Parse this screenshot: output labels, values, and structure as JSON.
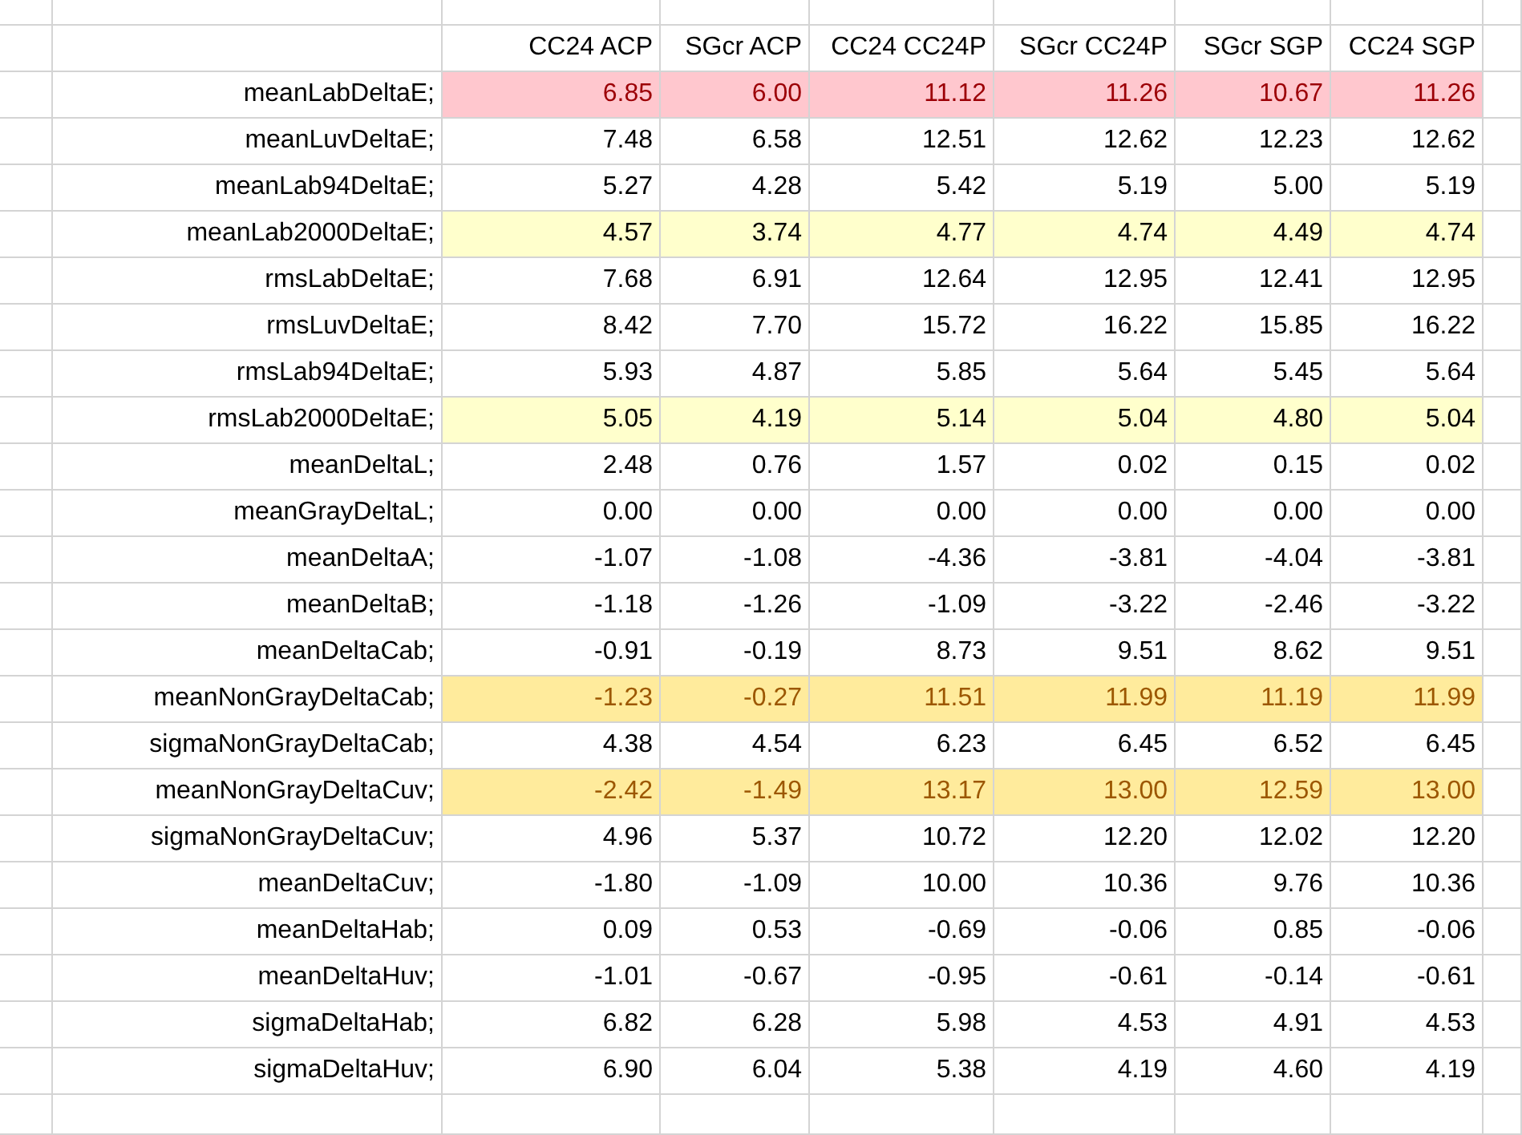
{
  "table": {
    "columns": [
      "CC24 ACP",
      "SGcr ACP",
      "CC24 CC24P",
      "SGcr CC24P",
      "SGcr SGP",
      "CC24 SGP"
    ],
    "rows": [
      {
        "label": "meanLabDeltaE;",
        "color": "#ffc7ce",
        "values": [
          "6.85",
          "6.00",
          "11.12",
          "11.26",
          "10.67",
          "11.26"
        ]
      },
      {
        "label": "meanLuvDeltaE;",
        "values": [
          "7.48",
          "6.58",
          "12.51",
          "12.62",
          "12.23",
          "12.62"
        ]
      },
      {
        "label": "meanLab94DeltaE;",
        "values": [
          "5.27",
          "4.28",
          "5.42",
          "5.19",
          "5.00",
          "5.19"
        ]
      },
      {
        "label": "meanLab2000DeltaE;",
        "color": "#ffffcc",
        "values": [
          "4.57",
          "3.74",
          "4.77",
          "4.74",
          "4.49",
          "4.74"
        ]
      },
      {
        "label": "rmsLabDeltaE;",
        "values": [
          "7.68",
          "6.91",
          "12.64",
          "12.95",
          "12.41",
          "12.95"
        ]
      },
      {
        "label": "rmsLuvDeltaE;",
        "values": [
          "8.42",
          "7.70",
          "15.72",
          "16.22",
          "15.85",
          "16.22"
        ]
      },
      {
        "label": "rmsLab94DeltaE;",
        "values": [
          "5.93",
          "4.87",
          "5.85",
          "5.64",
          "5.45",
          "5.64"
        ]
      },
      {
        "label": "rmsLab2000DeltaE;",
        "color": "#ffffcc",
        "values": [
          "5.05",
          "4.19",
          "5.14",
          "5.04",
          "4.80",
          "5.04"
        ]
      },
      {
        "label": "meanDeltaL;",
        "values": [
          "2.48",
          "0.76",
          "1.57",
          "0.02",
          "0.15",
          "0.02"
        ]
      },
      {
        "label": "meanGrayDeltaL;",
        "values": [
          "0.00",
          "0.00",
          "0.00",
          "0.00",
          "0.00",
          "0.00"
        ]
      },
      {
        "label": "meanDeltaA;",
        "values": [
          "-1.07",
          "-1.08",
          "-4.36",
          "-3.81",
          "-4.04",
          "-3.81"
        ]
      },
      {
        "label": "meanDeltaB;",
        "values": [
          "-1.18",
          "-1.26",
          "-1.09",
          "-3.22",
          "-2.46",
          "-3.22"
        ]
      },
      {
        "label": "meanDeltaCab;",
        "values": [
          "-0.91",
          "-0.19",
          "8.73",
          "9.51",
          "8.62",
          "9.51"
        ]
      },
      {
        "label": "meanNonGrayDeltaCab;",
        "color": "#ffeb9c",
        "values": [
          "-1.23",
          "-0.27",
          "11.51",
          "11.99",
          "11.19",
          "11.99"
        ]
      },
      {
        "label": "sigmaNonGrayDeltaCab;",
        "values": [
          "4.38",
          "4.54",
          "6.23",
          "6.45",
          "6.52",
          "6.45"
        ]
      },
      {
        "label": "meanNonGrayDeltaCuv;",
        "color": "#ffeb9c",
        "values": [
          "-2.42",
          "-1.49",
          "13.17",
          "13.00",
          "12.59",
          "13.00"
        ]
      },
      {
        "label": "sigmaNonGrayDeltaCuv;",
        "values": [
          "4.96",
          "5.37",
          "10.72",
          "12.20",
          "12.02",
          "12.20"
        ]
      },
      {
        "label": "meanDeltaCuv;",
        "values": [
          "-1.80",
          "-1.09",
          "10.00",
          "10.36",
          "9.76",
          "10.36"
        ]
      },
      {
        "label": "meanDeltaHab;",
        "values": [
          "0.09",
          "0.53",
          "-0.69",
          "-0.06",
          "0.85",
          "-0.06"
        ]
      },
      {
        "label": "meanDeltaHuv;",
        "values": [
          "-1.01",
          "-0.67",
          "-0.95",
          "-0.61",
          "-0.14",
          "-0.61"
        ]
      },
      {
        "label": "sigmaDeltaHab;",
        "values": [
          "6.82",
          "6.28",
          "5.98",
          "4.53",
          "4.91",
          "4.53"
        ]
      },
      {
        "label": "sigmaDeltaHuv;",
        "values": [
          "6.90",
          "6.04",
          "5.38",
          "4.19",
          "4.60",
          "4.19"
        ]
      }
    ]
  }
}
